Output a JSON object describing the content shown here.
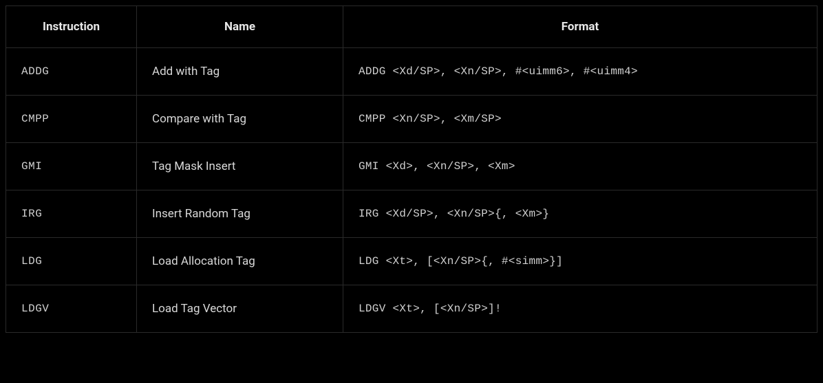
{
  "table": {
    "headers": {
      "instruction": "Instruction",
      "name": "Name",
      "format": "Format"
    },
    "rows": [
      {
        "instruction": "ADDG",
        "name": "Add with Tag",
        "format": "ADDG <Xd/SP>, <Xn/SP>, #<uimm6>, #<uimm4>"
      },
      {
        "instruction": "CMPP",
        "name": "Compare with Tag",
        "format": "CMPP <Xn/SP>, <Xm/SP>"
      },
      {
        "instruction": "GMI",
        "name": "Tag Mask Insert",
        "format": "GMI <Xd>, <Xn/SP>, <Xm>"
      },
      {
        "instruction": "IRG",
        "name": "Insert Random Tag",
        "format": "IRG <Xd/SP>, <Xn/SP>{, <Xm>}"
      },
      {
        "instruction": "LDG",
        "name": "Load Allocation Tag",
        "format": "LDG <Xt>, [<Xn/SP>{, #<simm>}]"
      },
      {
        "instruction": "LDGV",
        "name": "Load Tag Vector",
        "format": "LDGV <Xt>, [<Xn/SP>]!"
      }
    ]
  }
}
